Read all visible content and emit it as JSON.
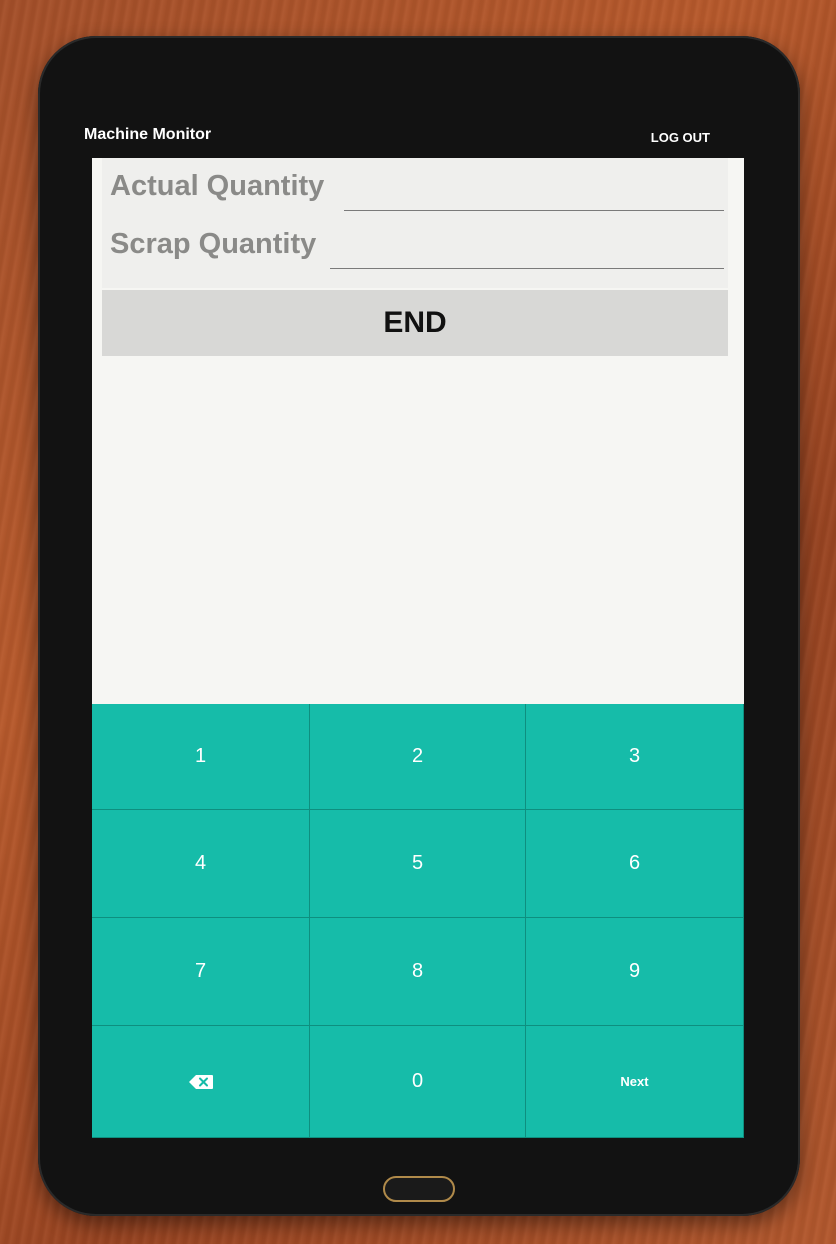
{
  "header": {
    "app_title": "Machine Monitor",
    "logout_label": "LOG OUT"
  },
  "form": {
    "actual_quantity_label": "Actual Quantity",
    "actual_quantity_value": "",
    "scrap_quantity_label": "Scrap Quantity",
    "scrap_quantity_value": "",
    "end_button_label": "END"
  },
  "keypad": {
    "keys": [
      "1",
      "2",
      "3",
      "4",
      "5",
      "6",
      "7",
      "8",
      "9",
      "",
      "0",
      "Next"
    ],
    "backspace_icon": "backspace-icon"
  },
  "colors": {
    "keypad_background": "#16bca9",
    "end_button_background": "#d8d8d6",
    "label_color": "#8a8a88"
  }
}
